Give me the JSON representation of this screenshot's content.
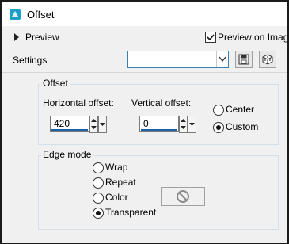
{
  "window": {
    "title": "Offset"
  },
  "preview_row": {
    "preview_label": "Preview",
    "preview_on_image_label": "Preview on Image",
    "preview_on_image_checked": true
  },
  "settings_row": {
    "label": "Settings",
    "combo_value": ""
  },
  "offset_group": {
    "title": "Offset",
    "horizontal": {
      "label": "Horizontal offset:",
      "value": "420"
    },
    "vertical": {
      "label": "Vertical offset:",
      "value": "0"
    },
    "options": [
      {
        "label": "Center",
        "selected": false
      },
      {
        "label": "Custom",
        "selected": true
      }
    ]
  },
  "edge_group": {
    "title": "Edge mode",
    "options": [
      {
        "label": "Wrap",
        "selected": false
      },
      {
        "label": "Repeat",
        "selected": false
      },
      {
        "label": "Color",
        "selected": false
      },
      {
        "label": "Transparent",
        "selected": true
      }
    ],
    "color_icon": "no-color-icon"
  },
  "colors": {
    "accent": "#1f5fa7",
    "app_icon": "#1aa0c8"
  }
}
